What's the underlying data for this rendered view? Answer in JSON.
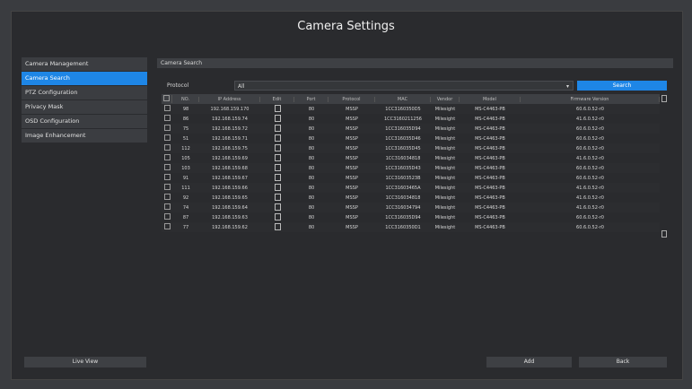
{
  "window_title": "Camera Settings",
  "sidebar": {
    "items": [
      {
        "label": "Camera Management"
      },
      {
        "label": "Camera Search"
      },
      {
        "label": "PTZ Configuration"
      },
      {
        "label": "Privacy Mask"
      },
      {
        "label": "OSD Configuration"
      },
      {
        "label": "Image Enhancement"
      }
    ],
    "active_index": 1
  },
  "main": {
    "header": "Camera Search",
    "protocol_label": "Protocol",
    "protocol_value": "All",
    "search_button": "Search"
  },
  "table": {
    "columns": [
      "",
      "NO.",
      "IP Address",
      "Edit",
      "Port",
      "Protocol",
      "MAC",
      "Vendor",
      "Model",
      "Firmware Version"
    ],
    "rows": [
      [
        "98",
        "192.168.159.170",
        "80",
        "MSSP",
        "1CC3160350D5",
        "Milesight",
        "MS-C4463-PB",
        "60.6.0.52-r0"
      ],
      [
        "86",
        "192.168.159.74",
        "80",
        "MSSP",
        "1CC3160211256",
        "Milesight",
        "MS-C4463-PB",
        "41.6.0.52-r0"
      ],
      [
        "75",
        "192.168.159.72",
        "80",
        "MSSP",
        "1CC316035D94",
        "Milesight",
        "MS-C4463-PB",
        "60.6.0.52-r0"
      ],
      [
        "51",
        "192.168.159.71",
        "80",
        "MSSP",
        "1CC316035D46",
        "Milesight",
        "MS-C4463-PB",
        "60.6.0.52-r0"
      ],
      [
        "112",
        "192.168.159.75",
        "80",
        "MSSP",
        "1CC316035D45",
        "Milesight",
        "MS-C4463-PB",
        "60.6.0.52-r0"
      ],
      [
        "105",
        "192.168.159.69",
        "80",
        "MSSP",
        "1CC316034818",
        "Milesight",
        "MS-C4463-PB",
        "41.6.0.52-r0"
      ],
      [
        "103",
        "192.168.159.68",
        "80",
        "MSSP",
        "1CC316035D43",
        "Milesight",
        "MS-C4463-PB",
        "60.6.0.52-r0"
      ],
      [
        "91",
        "192.168.159.67",
        "80",
        "MSSP",
        "1CC31603523B",
        "Milesight",
        "MS-C4463-PB",
        "60.6.0.52-r0"
      ],
      [
        "111",
        "192.168.159.66",
        "80",
        "MSSP",
        "1CC31603465A",
        "Milesight",
        "MS-C4463-PB",
        "41.6.0.52-r0"
      ],
      [
        "92",
        "192.168.159.65",
        "80",
        "MSSP",
        "1CC316034818",
        "Milesight",
        "MS-C4463-PB",
        "41.6.0.52-r0"
      ],
      [
        "74",
        "192.168.159.64",
        "80",
        "MSSP",
        "1CC316034794",
        "Milesight",
        "MS-C4463-PB",
        "41.6.0.52-r0"
      ],
      [
        "87",
        "192.168.159.63",
        "80",
        "MSSP",
        "1CC316035D94",
        "Milesight",
        "MS-C4463-PB",
        "60.6.0.52-r0"
      ],
      [
        "77",
        "192.168.159.62",
        "80",
        "MSSP",
        "1CC3160350D1",
        "Milesight",
        "MS-C4463-PB",
        "60.6.0.52-r0"
      ]
    ]
  },
  "footer": {
    "live_view": "Live View",
    "add": "Add",
    "back": "Back"
  }
}
